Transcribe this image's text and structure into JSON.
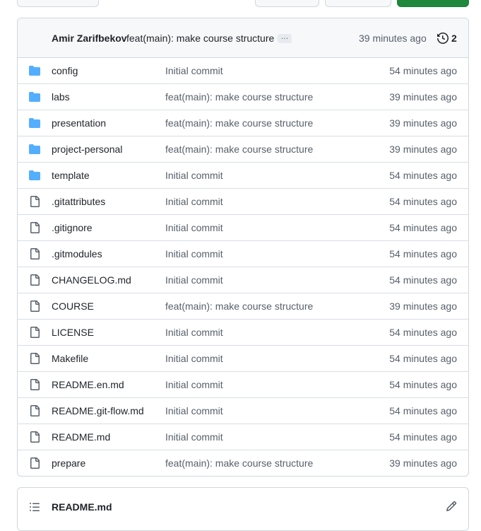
{
  "latest_commit": {
    "author": "Amir Zarifbekov",
    "message": "feat(main): make course structure",
    "ellipsis": "…",
    "time": "39 minutes ago",
    "history_count": "2"
  },
  "files": [
    {
      "type": "dir",
      "name": "config",
      "commit": "Initial commit",
      "time": "54 minutes ago"
    },
    {
      "type": "dir",
      "name": "labs",
      "commit": "feat(main): make course structure",
      "time": "39 minutes ago"
    },
    {
      "type": "dir",
      "name": "presentation",
      "commit": "feat(main): make course structure",
      "time": "39 minutes ago"
    },
    {
      "type": "dir",
      "name": "project-personal",
      "commit": "feat(main): make course structure",
      "time": "39 minutes ago"
    },
    {
      "type": "dir",
      "name": "template",
      "commit": "Initial commit",
      "time": "54 minutes ago"
    },
    {
      "type": "file",
      "name": ".gitattributes",
      "commit": "Initial commit",
      "time": "54 minutes ago"
    },
    {
      "type": "file",
      "name": ".gitignore",
      "commit": "Initial commit",
      "time": "54 minutes ago"
    },
    {
      "type": "file",
      "name": ".gitmodules",
      "commit": "Initial commit",
      "time": "54 minutes ago"
    },
    {
      "type": "file",
      "name": "CHANGELOG.md",
      "commit": "Initial commit",
      "time": "54 minutes ago"
    },
    {
      "type": "file",
      "name": "COURSE",
      "commit": "feat(main): make course structure",
      "time": "39 minutes ago"
    },
    {
      "type": "file",
      "name": "LICENSE",
      "commit": "Initial commit",
      "time": "54 minutes ago"
    },
    {
      "type": "file",
      "name": "Makefile",
      "commit": "Initial commit",
      "time": "54 minutes ago"
    },
    {
      "type": "file",
      "name": "README.en.md",
      "commit": "Initial commit",
      "time": "54 minutes ago"
    },
    {
      "type": "file",
      "name": "README.git-flow.md",
      "commit": "Initial commit",
      "time": "54 minutes ago"
    },
    {
      "type": "file",
      "name": "README.md",
      "commit": "Initial commit",
      "time": "54 minutes ago"
    },
    {
      "type": "file",
      "name": "prepare",
      "commit": "feat(main): make course structure",
      "time": "39 minutes ago"
    }
  ],
  "readme": {
    "title": "README.md"
  },
  "colors": {
    "folder": "#54aeff",
    "file_icon": "#57606a",
    "primary_button": "#1f883d"
  }
}
